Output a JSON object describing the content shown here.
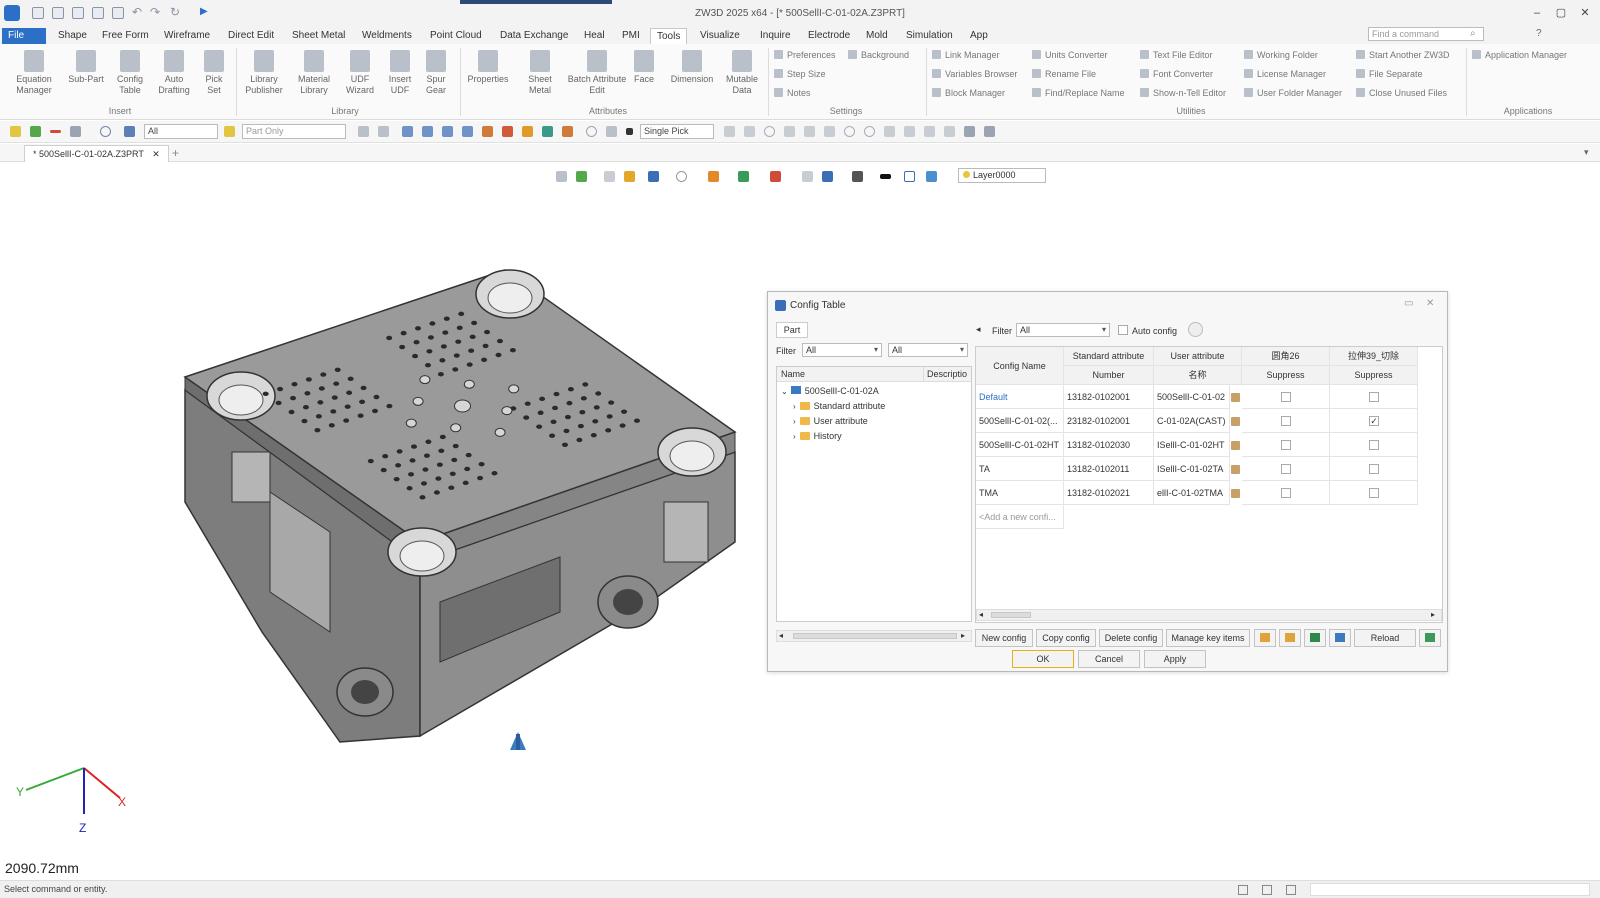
{
  "window": {
    "title": "ZW3D 2025 x64 - [* 500SellI-C-01-02A.Z3PRT]"
  },
  "menu": {
    "items": [
      "File",
      "Shape",
      "Free Form",
      "Wireframe",
      "Direct Edit",
      "Sheet Metal",
      "Weldments",
      "Point Cloud",
      "Data Exchange",
      "Heal",
      "PMI",
      "Tools",
      "Visualize",
      "Inquire",
      "Electrode",
      "Mold",
      "Simulation",
      "App"
    ],
    "active": "Tools",
    "search_placeholder": "Find a command"
  },
  "ribbon": {
    "insert": {
      "buttons": [
        {
          "l1": "Equation",
          "l2": "Manager"
        },
        {
          "l1": "Sub-Part",
          "l2": ""
        },
        {
          "l1": "Config",
          "l2": "Table"
        },
        {
          "l1": "Auto",
          "l2": "Drafting"
        },
        {
          "l1": "Pick",
          "l2": "Set"
        }
      ],
      "label": "Insert"
    },
    "library": {
      "buttons": [
        {
          "l1": "Library",
          "l2": "Publisher"
        },
        {
          "l1": "Material",
          "l2": "Library"
        },
        {
          "l1": "UDF",
          "l2": "Wizard"
        },
        {
          "l1": "Insert",
          "l2": "UDF"
        },
        {
          "l1": "Spur",
          "l2": "Gear"
        }
      ],
      "label": "Library"
    },
    "attributes": {
      "buttons": [
        {
          "l1": "Properties",
          "l2": ""
        },
        {
          "l1": "Sheet",
          "l2": "Metal"
        },
        {
          "l1": "Batch Attribute",
          "l2": "Edit"
        },
        {
          "l1": "Face",
          "l2": ""
        },
        {
          "l1": "Dimension",
          "l2": ""
        },
        {
          "l1": "Mutable",
          "l2": "Data"
        }
      ],
      "label": "Attributes"
    },
    "settings": {
      "items": [
        "Preferences",
        "Background",
        "Step Size",
        "Notes"
      ],
      "label": "Settings"
    },
    "utilities": {
      "items": [
        "Link Manager",
        "Variables Browser",
        "Block Manager",
        "Units Converter",
        "Rename File",
        "Find/Replace Name",
        "Text File Editor",
        "Font Converter",
        "Show-n-Tell Editor",
        "Working Folder",
        "License Manager",
        "User Folder Manager",
        "Start Another ZW3D",
        "File Separate",
        "Close Unused Files"
      ],
      "label": "Utilities"
    },
    "applications": {
      "items": [
        "Application Manager"
      ],
      "label": "Applications"
    }
  },
  "toolbar": {
    "filter_value": "All",
    "scope_value": "Part Only",
    "pick_value": "Single Pick"
  },
  "doc_tab": {
    "label": "* 500SellI-C-01-02A.Z3PRT"
  },
  "view_toolbar": {
    "layer": "Layer0000"
  },
  "viewport": {
    "distance": "2090.72mm",
    "axes": {
      "x": "X",
      "y": "Y",
      "z": "Z"
    }
  },
  "status": {
    "text": "Select command or entity."
  },
  "dialog": {
    "title": "Config Table",
    "part_tab": "Part",
    "left_filter_label": "Filter",
    "left_filter_value1": "All",
    "left_filter_value2": "All",
    "tree_headers": {
      "name": "Name",
      "desc": "Descriptio"
    },
    "tree": [
      {
        "label": "500SellI-C-01-02A",
        "level": 0
      },
      {
        "label": "Standard attribute",
        "level": 1
      },
      {
        "label": "User attribute",
        "level": 1
      },
      {
        "label": "History",
        "level": 1
      }
    ],
    "right_filter_label": "Filter",
    "right_filter_value": "All",
    "auto_config_label": "Auto config",
    "columns": {
      "config_name": "Config Name",
      "standard_attr": "Standard attribute",
      "standard_sub": "Number",
      "user_attr": "User attribute",
      "user_sub": "名称",
      "col4": "圆角26",
      "col4_sub": "Suppress",
      "col5": "拉伸39_切除",
      "col5_sub": "Suppress"
    },
    "rows": [
      {
        "name": "Default",
        "number": "13182-0102001",
        "user": "500SellI-C-01-02",
        "s1": false,
        "s2": false,
        "link": true
      },
      {
        "name": "500SellI-C-01-02(...",
        "number": "23182-0102001",
        "user": "C-01-02A(CAST)",
        "s1": false,
        "s2": true,
        "link": false
      },
      {
        "name": "500SellI-C-01-02HT",
        "number": "13182-0102030",
        "user": "ISellI-C-01-02HT",
        "s1": false,
        "s2": false,
        "link": false
      },
      {
        "name": "TA",
        "number": "13182-0102011",
        "user": "ISellI-C-01-02TA",
        "s1": false,
        "s2": false,
        "link": false
      },
      {
        "name": "TMA",
        "number": "13182-0102021",
        "user": "ellI-C-01-02TMA",
        "s1": false,
        "s2": false,
        "link": false
      }
    ],
    "add_row": "<Add a new confi...",
    "buttons": {
      "new_config": "New config",
      "copy_config": "Copy config",
      "delete_config": "Delete config",
      "manage_keys": "Manage key items",
      "reload": "Reload"
    },
    "footer": {
      "ok": "OK",
      "cancel": "Cancel",
      "apply": "Apply"
    }
  }
}
